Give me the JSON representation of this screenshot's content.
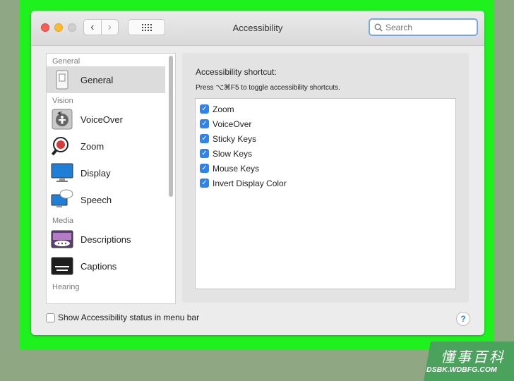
{
  "window": {
    "title": "Accessibility",
    "nav_back": "‹",
    "nav_forward": "›"
  },
  "search": {
    "placeholder": "Search"
  },
  "sidebar": {
    "groups": [
      {
        "header": "General",
        "items": [
          {
            "label": "General",
            "icon": "general-icon",
            "selected": true
          }
        ]
      },
      {
        "header": "Vision",
        "items": [
          {
            "label": "VoiceOver",
            "icon": "voiceover-icon"
          },
          {
            "label": "Zoom",
            "icon": "zoom-icon"
          },
          {
            "label": "Display",
            "icon": "display-icon"
          },
          {
            "label": "Speech",
            "icon": "speech-icon"
          }
        ]
      },
      {
        "header": "Media",
        "items": [
          {
            "label": "Descriptions",
            "icon": "descriptions-icon"
          },
          {
            "label": "Captions",
            "icon": "captions-icon"
          }
        ]
      },
      {
        "header": "Hearing",
        "items": []
      }
    ]
  },
  "pane": {
    "title": "Accessibility shortcut:",
    "description": "Press ⌥⌘F5 to toggle accessibility shortcuts.",
    "options": [
      {
        "label": "Zoom",
        "checked": true
      },
      {
        "label": "VoiceOver",
        "checked": true
      },
      {
        "label": "Sticky Keys",
        "checked": true
      },
      {
        "label": "Slow Keys",
        "checked": true
      },
      {
        "label": "Mouse Keys",
        "checked": true
      },
      {
        "label": "Invert Display Color",
        "checked": true
      }
    ]
  },
  "footer": {
    "menu_bar_label": "Show Accessibility status in menu bar",
    "menu_bar_checked": false,
    "help": "?"
  },
  "watermark": {
    "cn": "懂事百科",
    "url": "DSBK.WDBFG.COM"
  },
  "colors": {
    "frame": "#1ef11e",
    "accent": "#2f83ec",
    "watermark": "#4aa25c"
  }
}
